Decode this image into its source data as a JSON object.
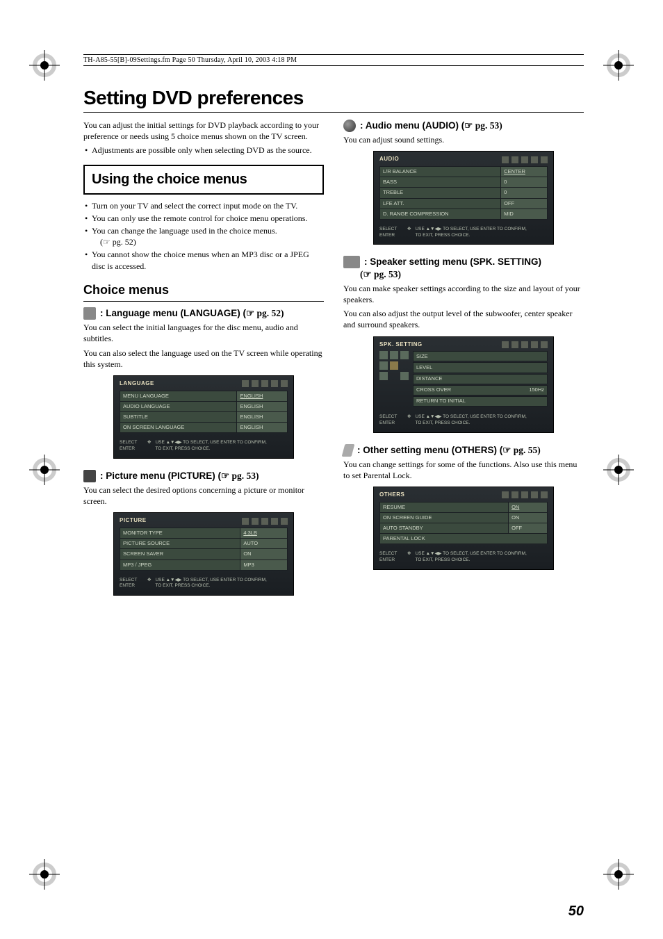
{
  "header_path": "TH-A85-55[B]-09Settings.fm  Page 50  Thursday, April 10, 2003  4:18 PM",
  "title": "Setting DVD preferences",
  "intro": "You can adjust the initial settings for DVD playback according to your preference or needs using 5 choice menus shown on the TV screen.",
  "intro_bullet": "Adjustments are possible only when selecting DVD as the source.",
  "using_heading": "Using the choice menus",
  "using_bullets": [
    "Turn on your TV and select the correct input mode on the TV.",
    "You can only use the remote control for choice menu operations.",
    "You can change the language used in the choice menus."
  ],
  "using_pgref": "(☞ pg. 52)",
  "using_bullet4": "You cannot show the choice menus when an MP3 disc or a JPEG disc is accessed.",
  "choice_heading": "Choice menus",
  "lang_heading": ": Language menu (LANGUAGE) (",
  "lang_pg": "☞ pg. 52)",
  "lang_p1": "You can select the initial languages for the disc menu, audio and subtitles.",
  "lang_p2": "You can also select the language used on the TV screen while operating this system.",
  "pic_heading": ": Picture menu (PICTURE) (",
  "pic_pg": "☞ pg. 53)",
  "pic_p1": "You can select the desired options concerning a picture or monitor screen.",
  "audio_heading": ": Audio menu (AUDIO) (",
  "audio_pg": "☞ pg. 53)",
  "audio_p1": "You can adjust sound settings.",
  "spk_heading": ": Speaker setting menu (SPK. SETTING)",
  "spk_pg_line": "(☞ pg. 53)",
  "spk_p1": "You can make speaker settings according to the size and layout of your speakers.",
  "spk_p2": "You can also adjust the output level of the subwoofer, center speaker and surround speakers.",
  "other_heading": ": Other setting menu (OTHERS) (",
  "other_pg": "☞ pg. 55)",
  "other_p1": "You can change settings for some of the functions. Also use this menu to set Parental Lock.",
  "osd_foot_select": "SELECT",
  "osd_foot_enter": "ENTER",
  "osd_foot_hint1": "USE ▲▼◀▶ TO SELECT,  USE ENTER TO CONFIRM,",
  "osd_foot_hint2": "TO EXIT, PRESS CHOICE.",
  "osd_lang": {
    "title": "LANGUAGE",
    "rows": [
      [
        "MENU LANGUAGE",
        "ENGLISH"
      ],
      [
        "AUDIO LANGUAGE",
        "ENGLISH"
      ],
      [
        "SUBTITLE",
        "ENGLISH"
      ],
      [
        "ON SCREEN LANGUAGE",
        "ENGLISH"
      ]
    ]
  },
  "osd_pic": {
    "title": "PICTURE",
    "rows": [
      [
        "MONITOR TYPE",
        "4:3LB"
      ],
      [
        "PICTURE SOURCE",
        "AUTO"
      ],
      [
        "SCREEN SAVER",
        "ON"
      ],
      [
        "MP3 / JPEG",
        "MP3"
      ]
    ]
  },
  "osd_audio": {
    "title": "AUDIO",
    "rows": [
      [
        "L/R BALANCE",
        "CENTER"
      ],
      [
        "BASS",
        "0"
      ],
      [
        "TREBLE",
        "0"
      ],
      [
        "LFE ATT.",
        "OFF"
      ],
      [
        "D. RANGE COMPRESSION",
        "MID"
      ]
    ]
  },
  "osd_spk": {
    "title": "SPK. SETTING",
    "items": [
      "SIZE",
      "LEVEL",
      "DISTANCE"
    ],
    "cross_label": "CROSS OVER",
    "cross_val": "150Hz",
    "return": "RETURN TO INITIAL"
  },
  "osd_other": {
    "title": "OTHERS",
    "rows": [
      [
        "RESUME",
        "ON"
      ],
      [
        "ON SCREEN GUIDE",
        "ON"
      ],
      [
        "AUTO STANDBY",
        "OFF"
      ],
      [
        "PARENTAL LOCK",
        ""
      ]
    ]
  },
  "page_number": "50"
}
